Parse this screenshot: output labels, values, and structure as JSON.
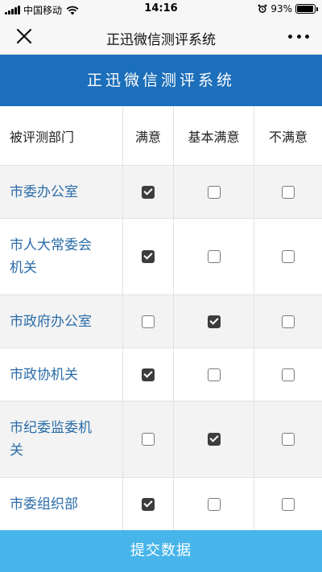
{
  "status_bar": {
    "carrier": "中国移动",
    "time": "14:16",
    "battery_percent": "93%",
    "battery_level": 0.93,
    "icons": [
      "signal-icon",
      "wifi-icon",
      "alarm-icon",
      "battery-icon"
    ]
  },
  "nav": {
    "title": "正迅微信测评系统",
    "icons": [
      "close-icon",
      "more-icon"
    ]
  },
  "banner": {
    "title": "正迅微信测评系统"
  },
  "table": {
    "headers": [
      "被评测部门",
      "满意",
      "基本满意",
      "不满意"
    ],
    "rows": [
      {
        "dept_line1": "市委办公室",
        "dept_line2": "",
        "selection": "满意"
      },
      {
        "dept_line1": "市人大常委会",
        "dept_line2": "机关",
        "selection": "满意"
      },
      {
        "dept_line1": "市政府办公室",
        "dept_line2": "",
        "selection": "基本满意"
      },
      {
        "dept_line1": "市政协机关",
        "dept_line2": "",
        "selection": "满意"
      },
      {
        "dept_line1": "市纪委监委机",
        "dept_line2": "关",
        "selection": "基本满意"
      },
      {
        "dept_line1": "市委组织部",
        "dept_line2": "",
        "selection": "满意"
      }
    ]
  },
  "submit_label": "提交数据",
  "colors": {
    "banner": "#1c6fba",
    "dept_text": "#2a6ca8",
    "submit": "#47b5ea",
    "row_alt": "#f3f3f3",
    "checkbox_checked": "#3d3d3d"
  }
}
